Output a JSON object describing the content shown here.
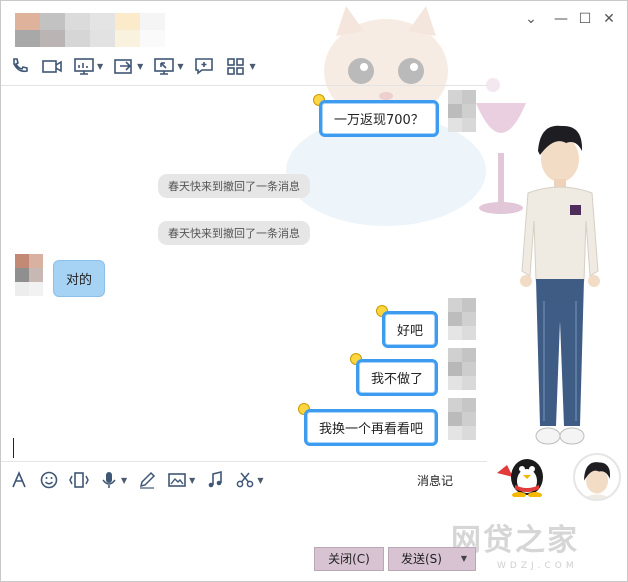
{
  "window": {
    "controls": {
      "menu": "⌄",
      "minimize": "—",
      "maximize": "☐",
      "close": "✕"
    }
  },
  "toolbar": {
    "items": [
      {
        "icon": "phone-icon"
      },
      {
        "icon": "video-camera-icon"
      },
      {
        "icon": "screen-share-icon",
        "dropdown": true
      },
      {
        "icon": "file-transfer-icon",
        "dropdown": true
      },
      {
        "icon": "remote-desktop-icon",
        "dropdown": true
      },
      {
        "icon": "add-chat-icon"
      },
      {
        "icon": "app-grid-icon",
        "dropdown": true
      }
    ]
  },
  "messages": [
    {
      "type": "sent",
      "text": "一万返现700？"
    },
    {
      "type": "notice",
      "text": "春天快来到撤回了一条消息"
    },
    {
      "type": "notice",
      "text": "春天快来到撤回了一条消息"
    },
    {
      "type": "received",
      "text": "对的"
    },
    {
      "type": "sent",
      "text": "好吧"
    },
    {
      "type": "sent",
      "text": "我不做了"
    },
    {
      "type": "sent",
      "text": "我换一个再看看吧"
    }
  ],
  "input_toolbar": {
    "items": [
      "font-icon",
      "emoji-icon",
      "shake-icon",
      "voice-icon",
      "handwriting-icon",
      "image-icon",
      "music-icon",
      "scissors-icon"
    ],
    "history_label": "消息记"
  },
  "buttons": {
    "close_label": "关闭(C)",
    "send_label": "发送(S)"
  },
  "watermark": {
    "text": "网贷之家",
    "sub": "WDZJ.COM"
  },
  "colors": {
    "bubble_border": "#3d9bf0",
    "received_bubble": "#a6d2f3",
    "button_bg": "#d7c3d2"
  }
}
